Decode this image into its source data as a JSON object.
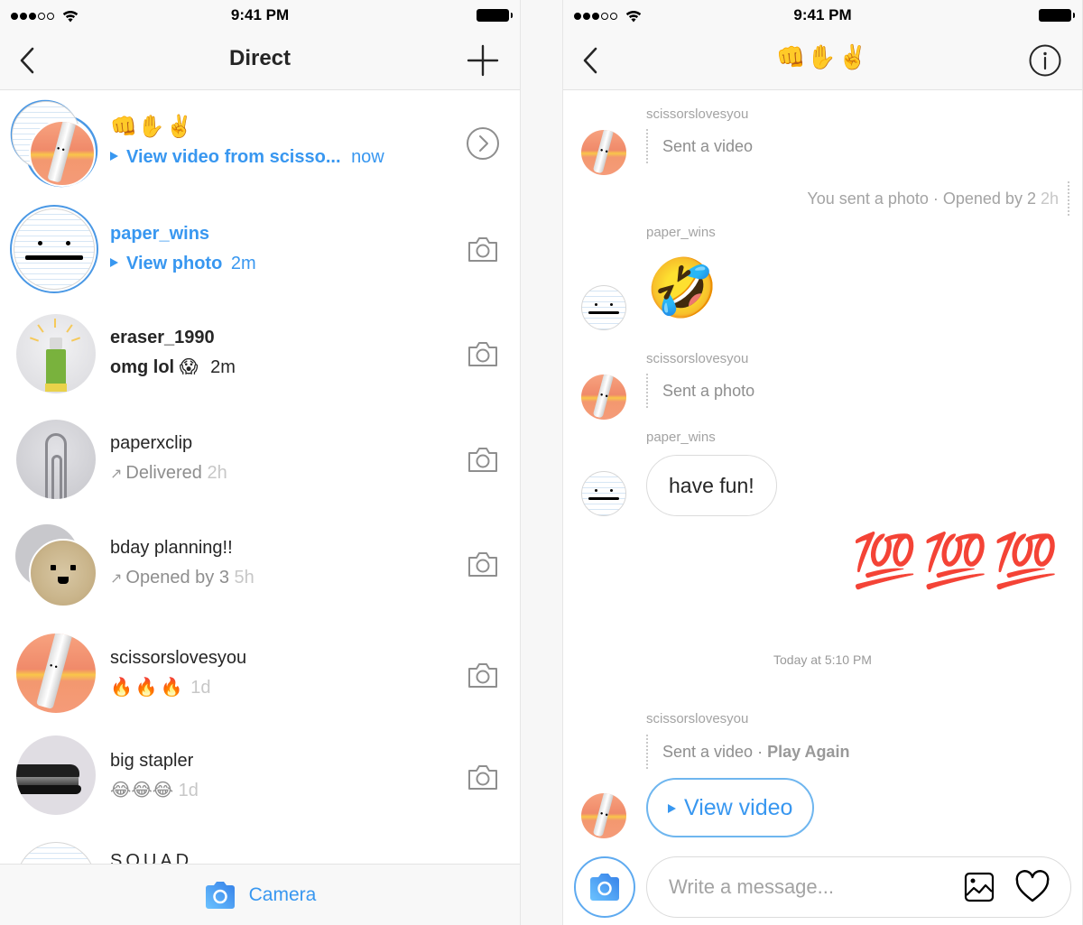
{
  "status_bar": {
    "time": "9:41 PM",
    "signal_bars_filled": 3,
    "signal_bars_total": 5
  },
  "inbox": {
    "title": "Direct",
    "back_icon": "chevron-left-icon",
    "new_icon": "plus-icon",
    "threads": [
      {
        "title": "👊✋✌️",
        "subtitle": "View video from scisso...",
        "time": "now",
        "style": "unread-video",
        "action_icon": "chevron-right-circle-icon",
        "avatar": "group-paper-scissors"
      },
      {
        "title": "paper_wins",
        "subtitle": "View photo",
        "time": "2m",
        "style": "unread-photo",
        "action_icon": "camera-icon",
        "avatar": "paper"
      },
      {
        "title": "eraser_1990",
        "subtitle": "omg lol 😱",
        "time": "2m",
        "style": "unread-text",
        "action_icon": "camera-icon",
        "avatar": "eraser"
      },
      {
        "title": "paperxclip",
        "subtitle": "Delivered",
        "time": "2h",
        "style": "sent",
        "action_icon": "camera-icon",
        "avatar": "paperclip"
      },
      {
        "title": "bday planning!!",
        "subtitle": "Opened by 3",
        "time": "5h",
        "style": "sent",
        "action_icon": "camera-icon",
        "avatar": "group-cork"
      },
      {
        "title": "scissorslovesyou",
        "subtitle": "🔥🔥🔥",
        "time": "1d",
        "style": "read",
        "action_icon": "camera-icon",
        "avatar": "scissors"
      },
      {
        "title": "big stapler",
        "subtitle": "😂😂😂",
        "time": "1d",
        "style": "read",
        "action_icon": "camera-icon",
        "avatar": "stapler"
      },
      {
        "title": "SQUAD",
        "subtitle": "",
        "time": "",
        "style": "partial",
        "action_icon": "",
        "avatar": "group-paper"
      }
    ],
    "bottom_label": "Camera"
  },
  "chat": {
    "title": "👊✋✌️",
    "messages": {
      "m1_user": "scissorslovesyou",
      "m1_text": "Sent a video",
      "m2_text": "You sent a photo · Opened by 2",
      "m2_time": "2h",
      "m3_user": "paper_wins",
      "m3_emoji": "🤣",
      "m4_user": "scissorslovesyou",
      "m4_text": "Sent a photo",
      "m5_user": "paper_wins",
      "m5_text": "have fun!",
      "m6_emoji": "💯💯💯",
      "timestamp": "Today at 5:10 PM",
      "m7_user": "scissorslovesyou",
      "m7_text": "Sent a video · ",
      "m7_action": "Play Again",
      "m8_button": "View video"
    },
    "composer": {
      "placeholder": "Write a message..."
    }
  },
  "colors": {
    "accent": "#3897f0",
    "text": "#262626",
    "secondary": "#8e8e8e",
    "muted": "#c7c7c7"
  }
}
